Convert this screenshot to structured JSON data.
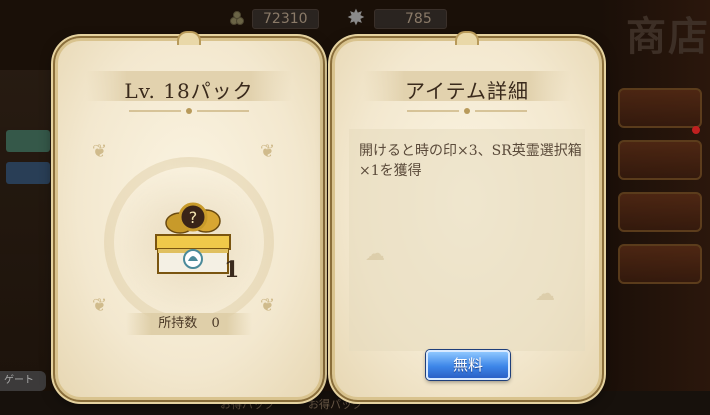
{
  "currency": {
    "coins": "72310",
    "stars": "785"
  },
  "background": {
    "shop_title": "商店",
    "bottom_labels": [
      "お得パック",
      "お得パック"
    ],
    "left_tab": "ゲート"
  },
  "left_panel": {
    "title": "Lv. 18パック",
    "quantity": "1",
    "owned_label": "所持数",
    "owned_count": "0"
  },
  "right_panel": {
    "title": "アイテム詳細",
    "description": "開けると時の印×3、SR英霊選択箱×1を獲得",
    "free_button": "無料"
  },
  "colors": {
    "button_blue": "#3d86e8",
    "panel_bg": "#f3e8cf",
    "gold_border": "#d9c38e"
  }
}
